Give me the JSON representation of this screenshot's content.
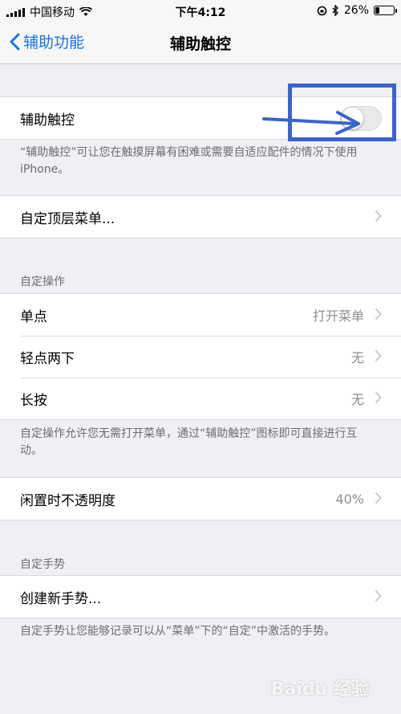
{
  "status_bar": {
    "carrier": "中国移动",
    "time": "下午4:12",
    "battery_percent": "26%",
    "battery_level": 0.26
  },
  "nav": {
    "back_label": "辅助功能",
    "title": "辅助触控"
  },
  "assistive_touch": {
    "label": "辅助触控",
    "toggle_on": false,
    "footer": "“辅助触控”可让您在触摸屏幕有困难或需要自适应配件的情况下使用 iPhone。"
  },
  "customize_menu": {
    "label": "自定顶层菜单..."
  },
  "custom_actions": {
    "header": "自定操作",
    "items": [
      {
        "label": "单点",
        "value": "打开菜单"
      },
      {
        "label": "轻点两下",
        "value": "无"
      },
      {
        "label": "长按",
        "value": "无"
      }
    ],
    "footer": "自定操作允许您无需打开菜单，通过“辅助触控”图标即可直接进行互动。"
  },
  "idle_opacity": {
    "label": "闲置时不透明度",
    "value": "40%"
  },
  "custom_gestures": {
    "header": "自定手势",
    "create_label": "创建新手势...",
    "footer": "自定手势让您能够记录可以从“菜单”下的“自定”中激活的手势。"
  },
  "watermark": "Baidu 经验",
  "colors": {
    "accent": "#1a73e8",
    "annotation": "#3c64c8",
    "background": "#efeff4"
  }
}
